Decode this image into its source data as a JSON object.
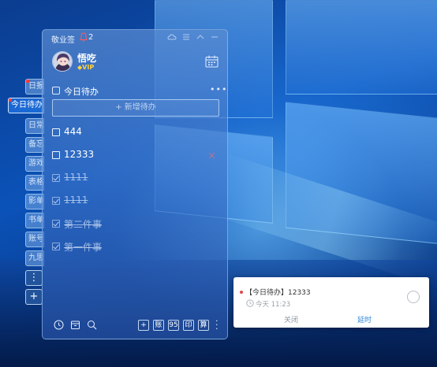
{
  "app": {
    "title": "敬业签",
    "notification_count": "2"
  },
  "user": {
    "name": "悟吃",
    "badge": "VIP"
  },
  "side_tabs": [
    {
      "label": "日报",
      "active": false
    },
    {
      "label": "今日待办",
      "active": true
    },
    {
      "label": "日常",
      "active": false
    },
    {
      "label": "备忘",
      "active": false
    },
    {
      "label": "游戏",
      "active": false
    },
    {
      "label": "表格",
      "active": false
    },
    {
      "label": "影单",
      "active": false
    },
    {
      "label": "书单",
      "active": false
    },
    {
      "label": "账号",
      "active": false
    },
    {
      "label": "九思",
      "active": false
    }
  ],
  "side_buttons": {
    "more": "⋮",
    "add": "+"
  },
  "list": {
    "title": "今日待办",
    "more": "•••",
    "add_placeholder": "+ 新增待办"
  },
  "todos": [
    {
      "text": "444",
      "done": false
    },
    {
      "text": "12333",
      "done": false,
      "flagged": true
    },
    {
      "text": "1111",
      "done": true
    },
    {
      "text": "1111",
      "done": true
    },
    {
      "text": "第二件事",
      "done": true
    },
    {
      "text": "第一件事",
      "done": true
    }
  ],
  "bottom_bar": {
    "account": "账",
    "number": "95",
    "print": "印",
    "calc": "算"
  },
  "notification": {
    "title": "【今日待办】12333",
    "time": "今天 11:23",
    "close": "关闭",
    "delay": "延时"
  },
  "colors": {
    "accent": "#2f86d8",
    "panel": "#4a80cc",
    "alert": "#e04848"
  }
}
